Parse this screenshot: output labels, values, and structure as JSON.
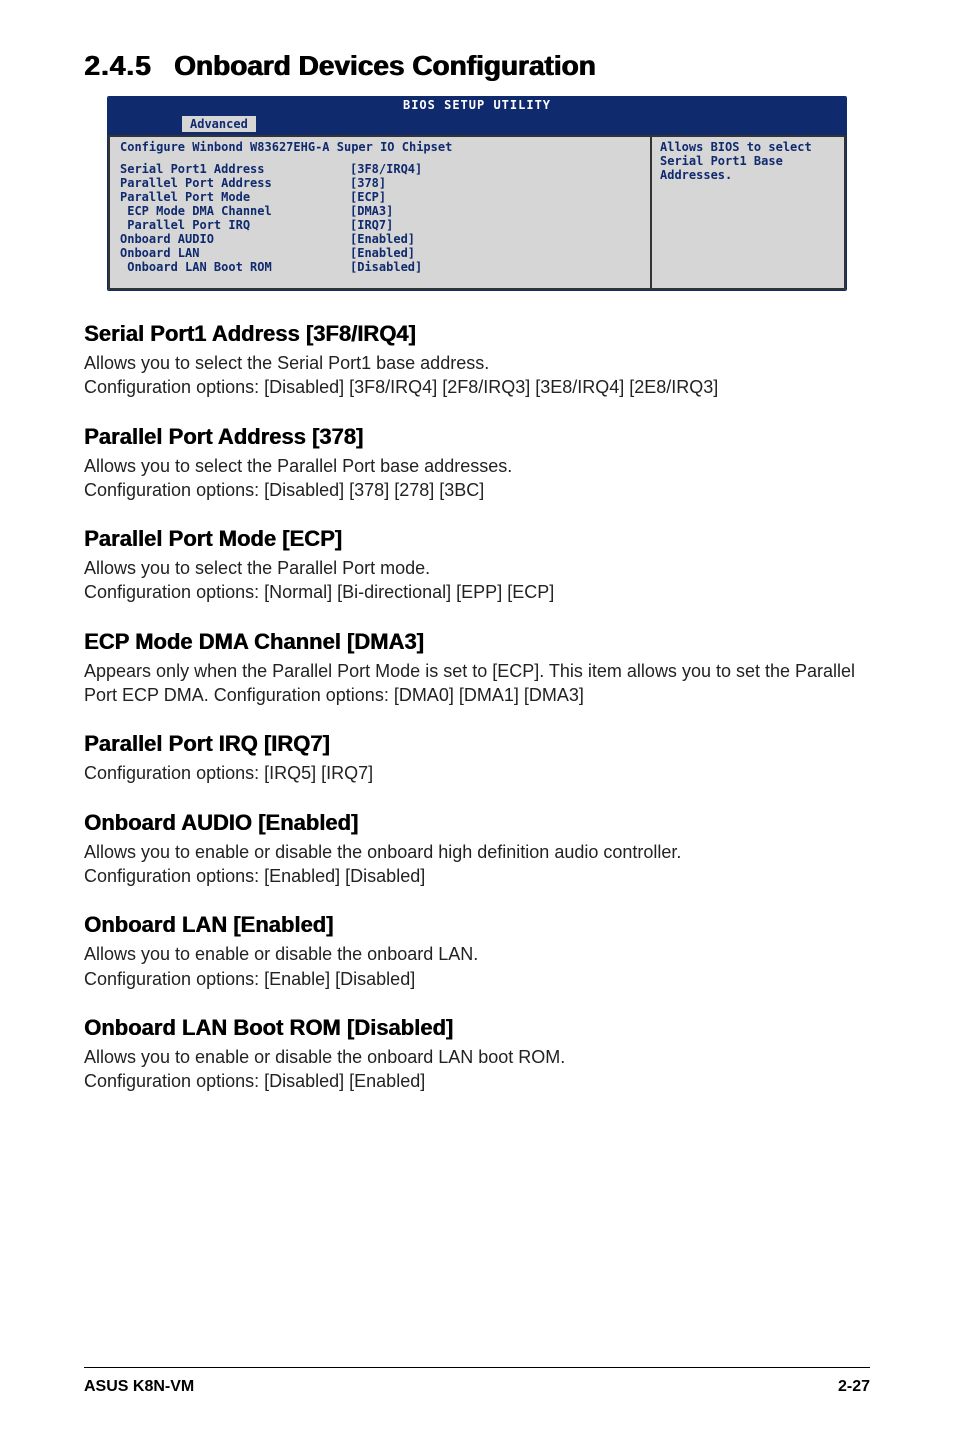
{
  "section": {
    "number": "2.4.5",
    "title": "Onboard Devices Configuration"
  },
  "bios": {
    "header": "BIOS SETUP UTILITY",
    "tab": "Advanced",
    "left_title": "Configure Winbond W83627EHG-A Super IO Chipset",
    "rows": [
      {
        "label": "Serial Port1 Address",
        "value": "[3F8/IRQ4]",
        "indent": 0
      },
      {
        "label": "Parallel Port Address",
        "value": "[378]",
        "indent": 0
      },
      {
        "label": "Parallel Port Mode",
        "value": "[ECP]",
        "indent": 0
      },
      {
        "label": "ECP Mode DMA Channel",
        "value": "[DMA3]",
        "indent": 1
      },
      {
        "label": "Parallel Port IRQ",
        "value": "[IRQ7]",
        "indent": 1
      },
      {
        "label": "Onboard AUDIO",
        "value": "[Enabled]",
        "indent": 0
      },
      {
        "label": "Onboard LAN",
        "value": "[Enabled]",
        "indent": 0
      },
      {
        "label": "Onboard LAN Boot ROM",
        "value": "[Disabled]",
        "indent": 1
      }
    ],
    "help": "Allows BIOS to select Serial Port1 Base Addresses."
  },
  "items": {
    "serial": {
      "heading": "Serial Port1 Address [3F8/IRQ4]",
      "desc": "Allows you to select the Serial Port1 base address.",
      "opts": "Configuration options: [Disabled] [3F8/IRQ4] [2F8/IRQ3] [3E8/IRQ4] [2E8/IRQ3]"
    },
    "paraddr": {
      "heading": "Parallel Port Address [378]",
      "desc": "Allows you to select the Parallel Port base addresses.",
      "opts": "Configuration options: [Disabled] [378] [278] [3BC]"
    },
    "parmode": {
      "heading": "Parallel Port Mode [ECP]",
      "desc": "Allows you to select the Parallel Port  mode.",
      "opts": "Configuration options: [Normal] [Bi-directional] [EPP] [ECP]"
    },
    "ecp": {
      "heading": "ECP Mode DMA Channel [DMA3]",
      "desc": "Appears only when the Parallel Port Mode is set to [ECP]. This item allows you to set the Parallel Port ECP DMA. Configuration options: [DMA0] [DMA1] [DMA3]"
    },
    "parirq": {
      "heading": "Parallel Port IRQ [IRQ7]",
      "opts": "Configuration options: [IRQ5] [IRQ7]"
    },
    "audio": {
      "heading": "Onboard AUDIO [Enabled]",
      "desc": "Allows you to enable or disable the onboard high definition audio controller.",
      "opts": "Configuration options: [Enabled] [Disabled]"
    },
    "lan": {
      "heading": "Onboard LAN [Enabled]",
      "desc": "Allows you to enable or disable the onboard LAN.",
      "opts": "Configuration options: [Enable] [Disabled]"
    },
    "lanrom": {
      "heading": "Onboard LAN Boot ROM [Disabled]",
      "desc": "Allows you to enable or disable the onboard LAN boot ROM.",
      "opts": "Configuration options: [Disabled] [Enabled]"
    }
  },
  "footer": {
    "left": "ASUS K8N-VM",
    "right": "2-27"
  }
}
